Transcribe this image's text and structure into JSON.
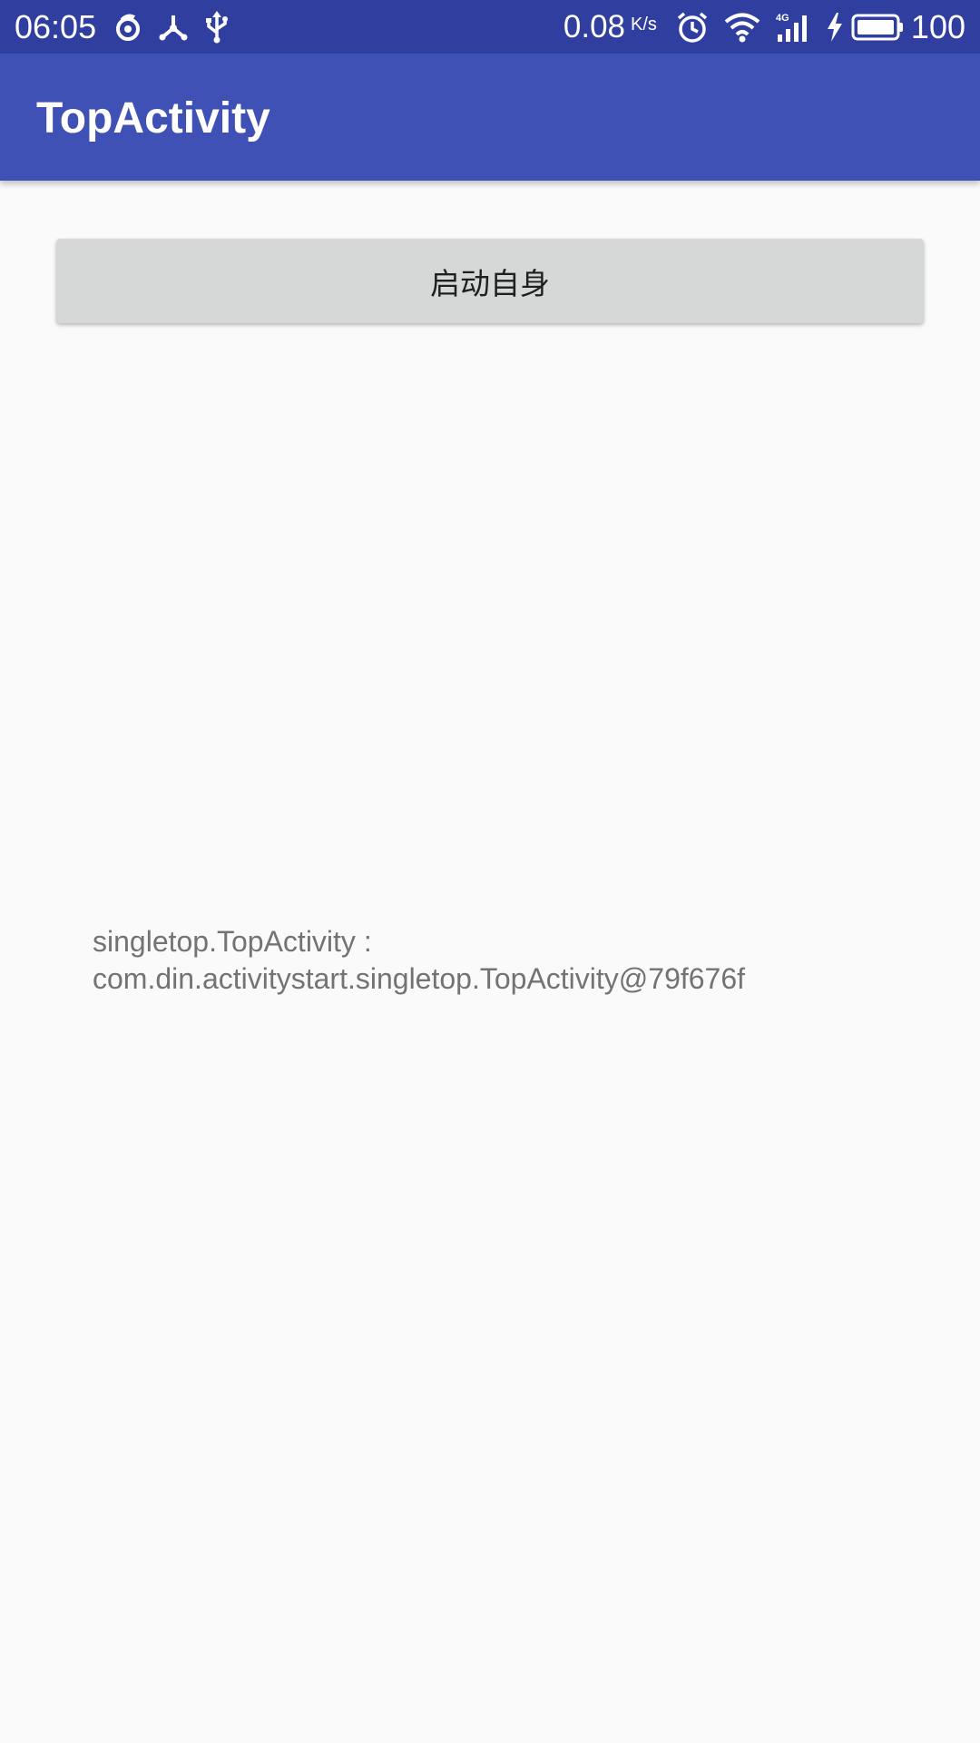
{
  "status_bar": {
    "time": "06:05",
    "left_icons": [
      "ring-notification-icon",
      "share-network-icon",
      "usb-icon"
    ],
    "network_speed": "0.08",
    "network_speed_unit": "K/s",
    "right_icons": [
      "alarm-icon",
      "wifi-icon",
      "signal-4g-icon",
      "charging-icon",
      "battery-icon"
    ],
    "signal_label": "4G",
    "battery_percent": "100"
  },
  "app_bar": {
    "title": "TopActivity",
    "color": "#3f51b5",
    "status_color": "#303f9f"
  },
  "main": {
    "button_label": "启动自身",
    "info_line1": "singletop.TopActivity :",
    "info_line2": "com.din.activitystart.singletop.TopActivity@79f676f"
  }
}
